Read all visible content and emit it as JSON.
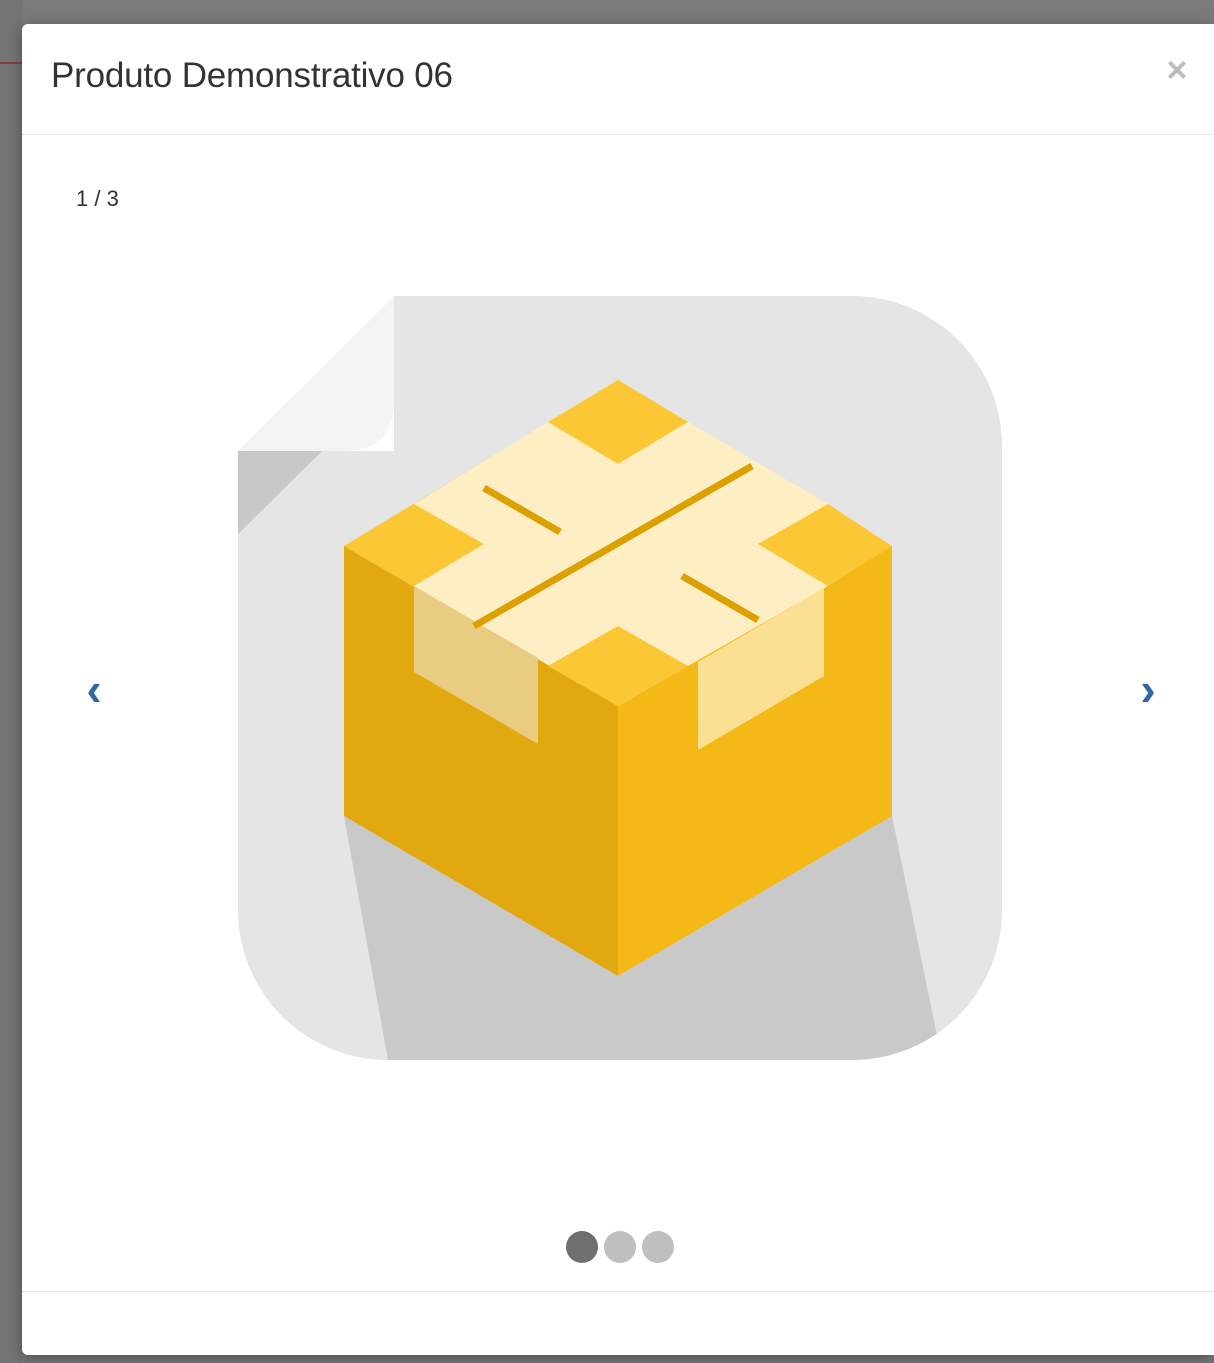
{
  "modal": {
    "title": "Produto Demonstrativo 06",
    "close_label": "×"
  },
  "carousel": {
    "counter": "1 / 3",
    "prev_label": "‹",
    "next_label": "›",
    "current_index": 1,
    "total_slides": 3,
    "image_icon": "package-box-icon"
  },
  "colors": {
    "accent": "#2f6aa8",
    "box_front_left": "#e2a810",
    "box_front_right": "#f4b817",
    "box_top": "#fbc734",
    "tape": "#fdeec4",
    "tile": "#e5e5e5",
    "dot_active": "#6f6f6f",
    "dot_inactive": "#bfbfbf"
  }
}
